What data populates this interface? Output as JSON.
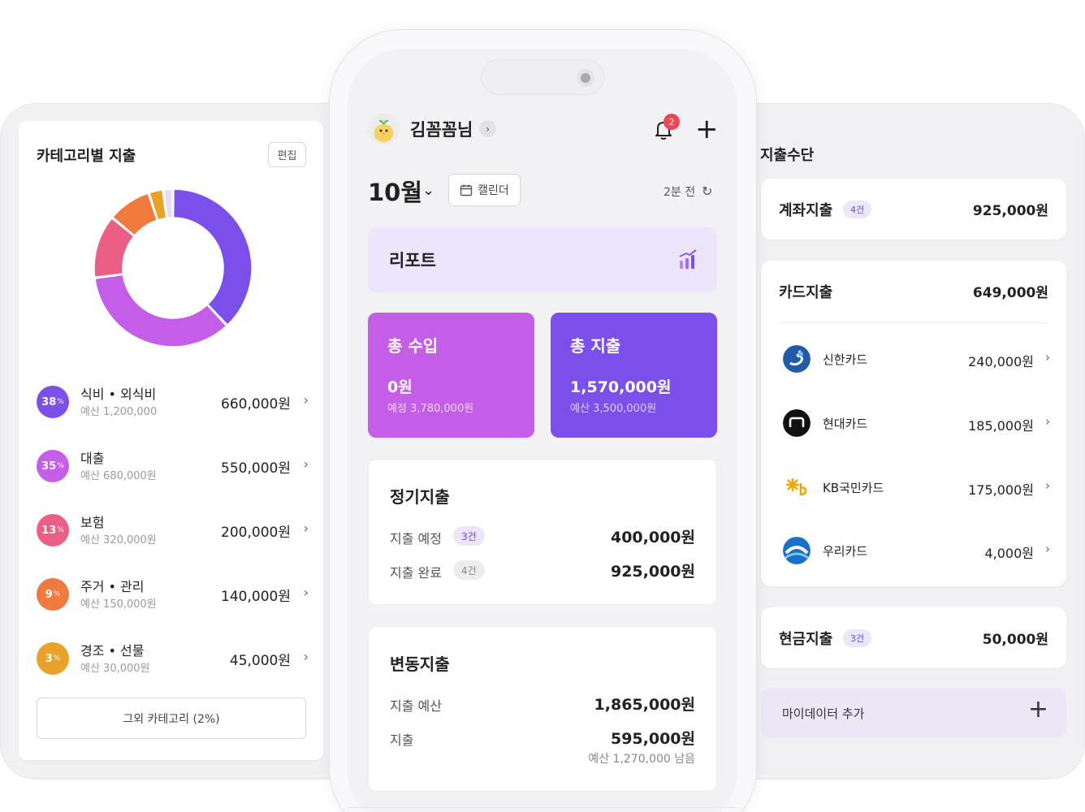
{
  "category_panel": {
    "title": "카테고리별 지출",
    "edit_label": "편집",
    "items": [
      {
        "pct": "38",
        "pct_unit": "%",
        "name": "식비 • 외식비",
        "budget": "예산 1,200,000",
        "amount": "660,000원",
        "color": "#7b4fe9"
      },
      {
        "pct": "35",
        "pct_unit": "%",
        "name": "대출",
        "budget": "예산 680,000원",
        "amount": "550,000원",
        "color": "#c45ee9"
      },
      {
        "pct": "13",
        "pct_unit": "%",
        "name": "보험",
        "budget": "예산 320,000원",
        "amount": "200,000원",
        "color": "#ec5f84"
      },
      {
        "pct": "9",
        "pct_unit": "%",
        "name": "주거 • 관리",
        "budget": "예산 150,000원",
        "amount": "140,000원",
        "color": "#f07a3c"
      },
      {
        "pct": "3",
        "pct_unit": "%",
        "name": "경조 • 선물",
        "budget": "예산 30,000원",
        "amount": "45,000원",
        "color": "#e8a22a"
      }
    ],
    "other_label": "그외 카테고리 (2%)",
    "other_color": "#e7dcfb"
  },
  "phone": {
    "username": "김꼼꼼님",
    "notification_count": "2",
    "month": "10월",
    "calendar_label": "캘린더",
    "updated": "2분 전",
    "report_label": "리포트",
    "income": {
      "title": "총 수입",
      "amount": "0원",
      "sub": "예정 3,780,000원"
    },
    "expense": {
      "title": "총 지출",
      "amount": "1,570,000원",
      "sub": "예산 3,500,000원"
    },
    "regular": {
      "title": "정기지출",
      "rows": [
        {
          "label": "지출 예정",
          "badge": "3건",
          "amount": "400,000원"
        },
        {
          "label": "지출 완료",
          "badge": "4건",
          "amount": "925,000원"
        }
      ]
    },
    "variable": {
      "title": "변동지출",
      "rows": [
        {
          "label": "지출 예산",
          "amount": "1,865,000원"
        },
        {
          "label": "지출",
          "amount": "595,000원"
        }
      ],
      "remaining": "예산 1,270,000 남음"
    }
  },
  "method_panel": {
    "title": "지출수단",
    "account": {
      "label": "계좌지출",
      "badge": "4건",
      "amount": "925,000원"
    },
    "card": {
      "label": "카드지출",
      "amount": "649,000원",
      "items": [
        {
          "name": "신한카드",
          "amount": "240,000원",
          "icon": "shinhan-logo-icon"
        },
        {
          "name": "현대카드",
          "amount": "185,000원",
          "icon": "hyundai-logo-icon"
        },
        {
          "name": "KB국민카드",
          "amount": "175,000원",
          "icon": "kb-logo-icon"
        },
        {
          "name": "우리카드",
          "amount": "4,000원",
          "icon": "woori-logo-icon"
        }
      ]
    },
    "cash": {
      "label": "현금지출",
      "badge": "3건",
      "amount": "50,000원"
    },
    "mydata_label": "마이데이터 추가"
  },
  "chart_data": {
    "type": "pie",
    "categories": [
      "식비 • 외식비",
      "대출",
      "보험",
      "주거 • 관리",
      "경조 • 선물",
      "그외 카테고리"
    ],
    "values": [
      38,
      35,
      13,
      9,
      3,
      2
    ]
  }
}
